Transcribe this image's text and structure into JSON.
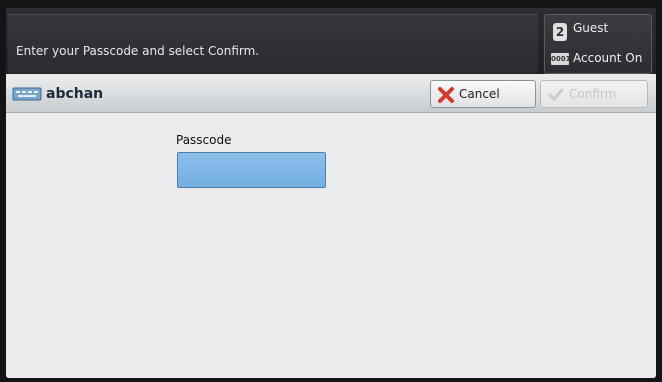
{
  "header": {
    "message": "Enter your Passcode and select Confirm.",
    "guest_label": "Guest",
    "account_label": "Account On",
    "counter_icon_text": "0001"
  },
  "titlebar": {
    "user_name": "abchan",
    "cancel_label": "Cancel",
    "confirm_label": "Confirm"
  },
  "form": {
    "passcode_label": "Passcode",
    "passcode_value": ""
  },
  "icons": {
    "user": "user-keyboard-icon",
    "cancel": "cancel-x-icon",
    "confirm": "checkmark-icon",
    "guest": "guest-icon",
    "counter": "counter-icon"
  },
  "colors": {
    "passcode_field": "#84baea",
    "cancel_x": "#d23b2c",
    "confirm_disabled": "#c4c7ca"
  }
}
